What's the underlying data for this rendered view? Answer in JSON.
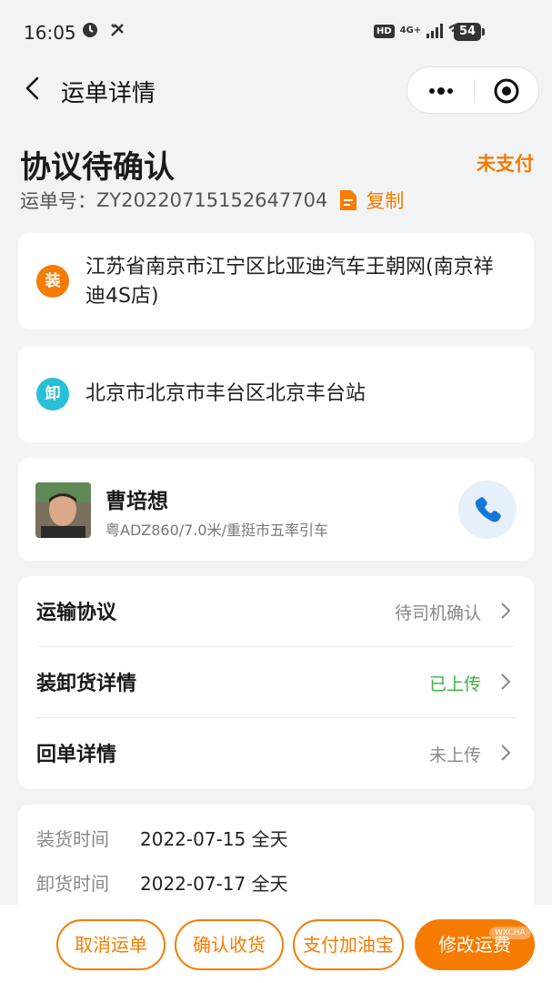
{
  "status_bar": {
    "time": "16:05",
    "network": "4G+",
    "hd": "HD",
    "battery": "54"
  },
  "nav": {
    "title": "运单详情"
  },
  "header": {
    "title": "协议待确认",
    "pay_status": "未支付",
    "order_label": "运单号：",
    "order_number": "ZY20220715152647704",
    "copy_label": "复制"
  },
  "addresses": {
    "load_badge": "装",
    "load_address": "江苏省南京市江宁区比亚迪汽车王朝网(南京祥迪4S店)",
    "unload_badge": "卸",
    "unload_address": "北京市北京市丰台区北京丰台站"
  },
  "driver": {
    "name": "曹培想",
    "info": "粤ADZ860/7.0米/重挺市五率引车"
  },
  "details": [
    {
      "label": "运输协议",
      "value": "待司机确认"
    },
    {
      "label": "装卸货详情",
      "value": "已上传"
    },
    {
      "label": "回单详情",
      "value": "未上传"
    }
  ],
  "times": {
    "load_label": "装货时间",
    "load_value": "2022-07-15 全天",
    "unload_label": "卸货时间",
    "unload_value": "2022-07-17 全天"
  },
  "actions": {
    "cancel": "取消运单",
    "confirm": "确认收货",
    "pay": "支付加油宝",
    "modify": "修改运费"
  },
  "watermark": "WXCHA",
  "colors": {
    "accent": "#f57c00",
    "success": "#3cb043",
    "unload_badge": "#26c0d8",
    "call": "#1677d9"
  }
}
